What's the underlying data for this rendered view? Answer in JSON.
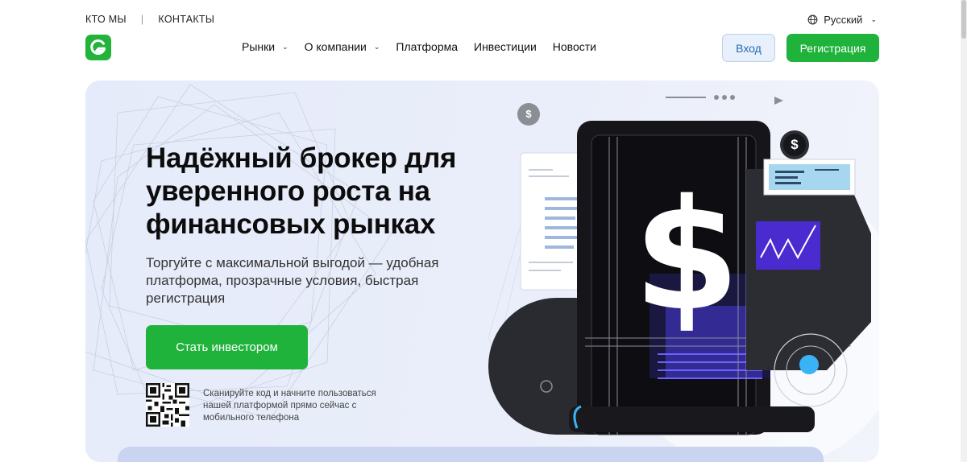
{
  "top_links": {
    "about": "КТО МЫ",
    "separator": "|",
    "contacts": "КОНТАКТЫ"
  },
  "language": {
    "label": "Русский",
    "icon": "globe-icon"
  },
  "nav": {
    "items": [
      {
        "label": "Рынки",
        "has_dropdown": true
      },
      {
        "label": "О компании",
        "has_dropdown": true
      },
      {
        "label": "Платформа",
        "has_dropdown": false
      },
      {
        "label": "Инвестиции",
        "has_dropdown": false
      },
      {
        "label": "Новости",
        "has_dropdown": false
      }
    ],
    "login": "Вход",
    "register": "Регистрация"
  },
  "hero": {
    "title": "Надёжный брокер для уверенного роста на финансовых рынках",
    "subtitle": "Торгуйте с максимальной выгодой — удобная платформа, прозрачные условия, быстрая регистрация",
    "cta": "Стать инвестором",
    "qr_text": "Сканируйте код и начните пользоваться нашей платформой прямо сейчас с мобильного телефона",
    "image_symbol": "$"
  },
  "colors": {
    "accent_green": "#1fb33b",
    "login_text": "#2a6ab4",
    "hero_bg": "#e8edfa"
  }
}
